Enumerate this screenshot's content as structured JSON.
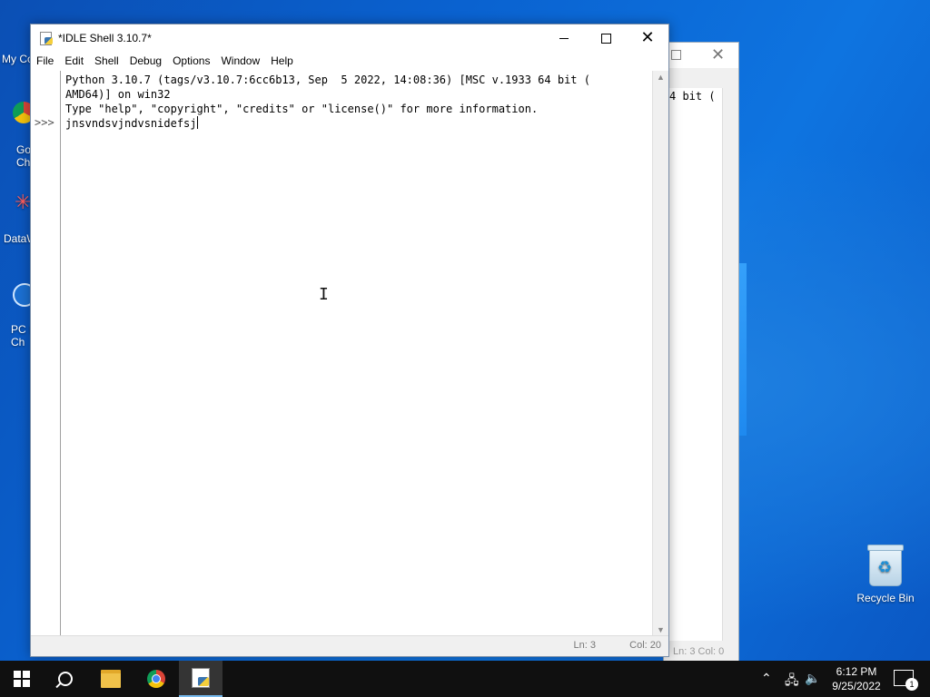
{
  "desktop": {
    "recycle_label": "Recycle Bin",
    "left_icons": [
      {
        "label": "My Co"
      },
      {
        "label": "Go\nCh"
      },
      {
        "label": "DataW"
      },
      {
        "label": "PC H\nCh"
      }
    ]
  },
  "background_window": {
    "text_fragment": "4 bit (",
    "status": "Ln: 3   Col: 0"
  },
  "window": {
    "title": "*IDLE Shell 3.10.7*",
    "menu": [
      "File",
      "Edit",
      "Shell",
      "Debug",
      "Options",
      "Window",
      "Help"
    ],
    "prompt": ">>>",
    "lines": [
      "Python 3.10.7 (tags/v3.10.7:6cc6b13, Sep  5 2022, 14:08:36) [MSC v.1933 64 bit (",
      "AMD64)] on win32",
      "Type \"help\", \"copyright\", \"credits\" or \"license()\" for more information."
    ],
    "input_line": "jnsvndsvjndvsnidefsj",
    "status_ln": "Ln: 3",
    "status_col": "Col: 20"
  },
  "taskbar": {
    "time": "6:12 PM",
    "date": "9/25/2022",
    "notification_count": "1",
    "apps": [
      "start-icon",
      "search-icon",
      "file-explorer-icon",
      "chrome-icon",
      "idle-icon"
    ]
  }
}
